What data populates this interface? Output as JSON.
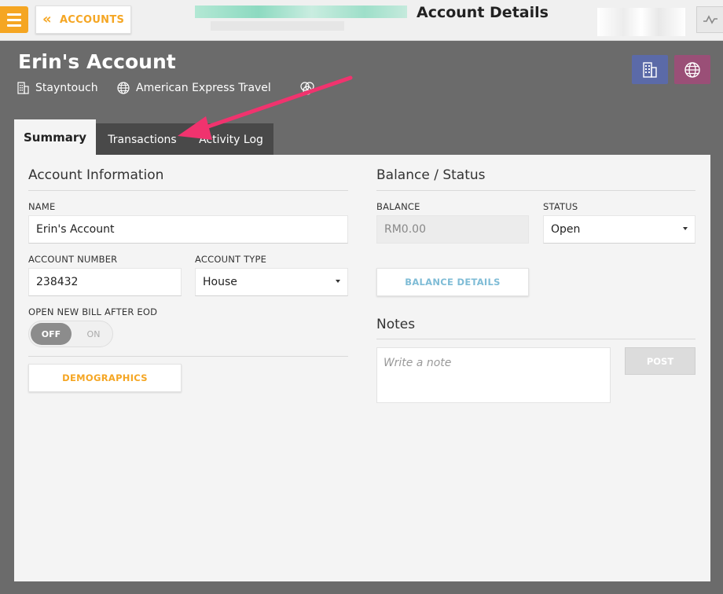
{
  "topbar": {
    "back_label": "ACCOUNTS",
    "page_title": "Account Details"
  },
  "header": {
    "account_name": "Erin's Account",
    "company": "Stayntouch",
    "travel_agent": "American Express Travel",
    "company_icon": "building-icon",
    "agent_icon": "globe-icon"
  },
  "tabs": [
    {
      "label": "Summary",
      "active": true
    },
    {
      "label": "Transactions",
      "active": false
    },
    {
      "label": "Activity Log",
      "active": false
    }
  ],
  "account_info": {
    "title": "Account Information",
    "name_label": "NAME",
    "name_value": "Erin's Account",
    "number_label": "ACCOUNT NUMBER",
    "number_value": "238432",
    "type_label": "ACCOUNT TYPE",
    "type_value": "House",
    "bill_label": "OPEN NEW BILL AFTER EOD",
    "toggle_off": "OFF",
    "toggle_on": "ON",
    "demographics_label": "DEMOGRAPHICS"
  },
  "balance": {
    "title": "Balance / Status",
    "balance_label": "BALANCE",
    "balance_value": "RM0.00",
    "status_label": "STATUS",
    "status_value": "Open",
    "details_label": "BALANCE DETAILS"
  },
  "notes": {
    "title": "Notes",
    "placeholder": "Write a note",
    "post_label": "POST"
  },
  "colors": {
    "accent": "#f5a623",
    "balance_details": "#7fbcd6",
    "annotation_arrow": "#f0336e"
  }
}
